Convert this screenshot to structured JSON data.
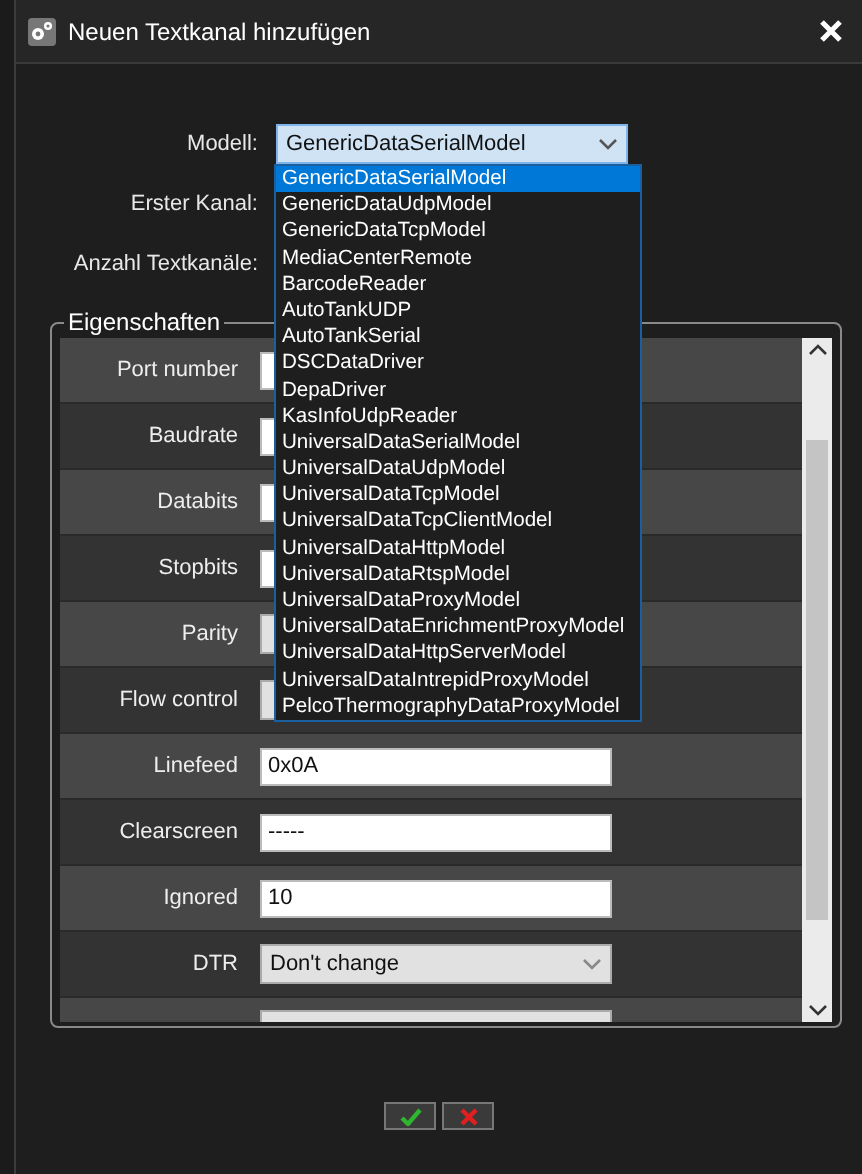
{
  "window": {
    "title": "Neuen Textkanal hinzufügen"
  },
  "form": {
    "model_label": "Modell:",
    "model_value": "GenericDataSerialModel",
    "first_channel_label": "Erster Kanal:",
    "count_label": "Anzahl Textkanäle:"
  },
  "model_dropdown": {
    "expanded": true,
    "options": [
      {
        "label": "GenericDataSerialModel",
        "selected": true
      },
      {
        "label": "GenericDataUdpModel",
        "selected": false
      },
      {
        "label": "GenericDataTcpModel",
        "selected": false
      },
      {
        "label": "MediaCenterRemote",
        "selected": false
      },
      {
        "label": "BarcodeReader",
        "selected": false
      },
      {
        "label": "AutoTankUDP",
        "selected": false
      },
      {
        "label": "AutoTankSerial",
        "selected": false
      },
      {
        "label": "DSCDataDriver",
        "selected": false
      },
      {
        "label": "DepaDriver",
        "selected": false
      },
      {
        "label": "KasInfoUdpReader",
        "selected": false
      },
      {
        "label": "UniversalDataSerialModel",
        "selected": false
      },
      {
        "label": "UniversalDataUdpModel",
        "selected": false
      },
      {
        "label": "UniversalDataTcpModel",
        "selected": false
      },
      {
        "label": "UniversalDataTcpClientModel",
        "selected": false
      },
      {
        "label": "UniversalDataHttpModel",
        "selected": false
      },
      {
        "label": "UniversalDataRtspModel",
        "selected": false
      },
      {
        "label": "UniversalDataProxyModel",
        "selected": false
      },
      {
        "label": "UniversalDataEnrichmentProxyModel",
        "selected": false
      },
      {
        "label": "UniversalDataHttpServerModel",
        "selected": false
      },
      {
        "label": "UniversalDataIntrepidProxyModel",
        "selected": false
      },
      {
        "label": "PelcoThermographyDataProxyModel",
        "selected": false
      }
    ]
  },
  "properties": {
    "title": "Eigenschaften",
    "rows": [
      {
        "label": "Port number",
        "kind": "text"
      },
      {
        "label": "Baudrate",
        "kind": "text"
      },
      {
        "label": "Databits",
        "kind": "text"
      },
      {
        "label": "Stopbits",
        "kind": "text"
      },
      {
        "label": "Parity",
        "kind": "select"
      },
      {
        "label": "Flow control",
        "kind": "select"
      },
      {
        "label": "Linefeed",
        "kind": "text",
        "value": "0x0A"
      },
      {
        "label": "Clearscreen",
        "kind": "text",
        "value": "-----"
      },
      {
        "label": "Ignored",
        "kind": "text",
        "value": "10"
      },
      {
        "label": "DTR",
        "kind": "select",
        "value": "Don't change"
      },
      {
        "kind": "select"
      }
    ]
  }
}
